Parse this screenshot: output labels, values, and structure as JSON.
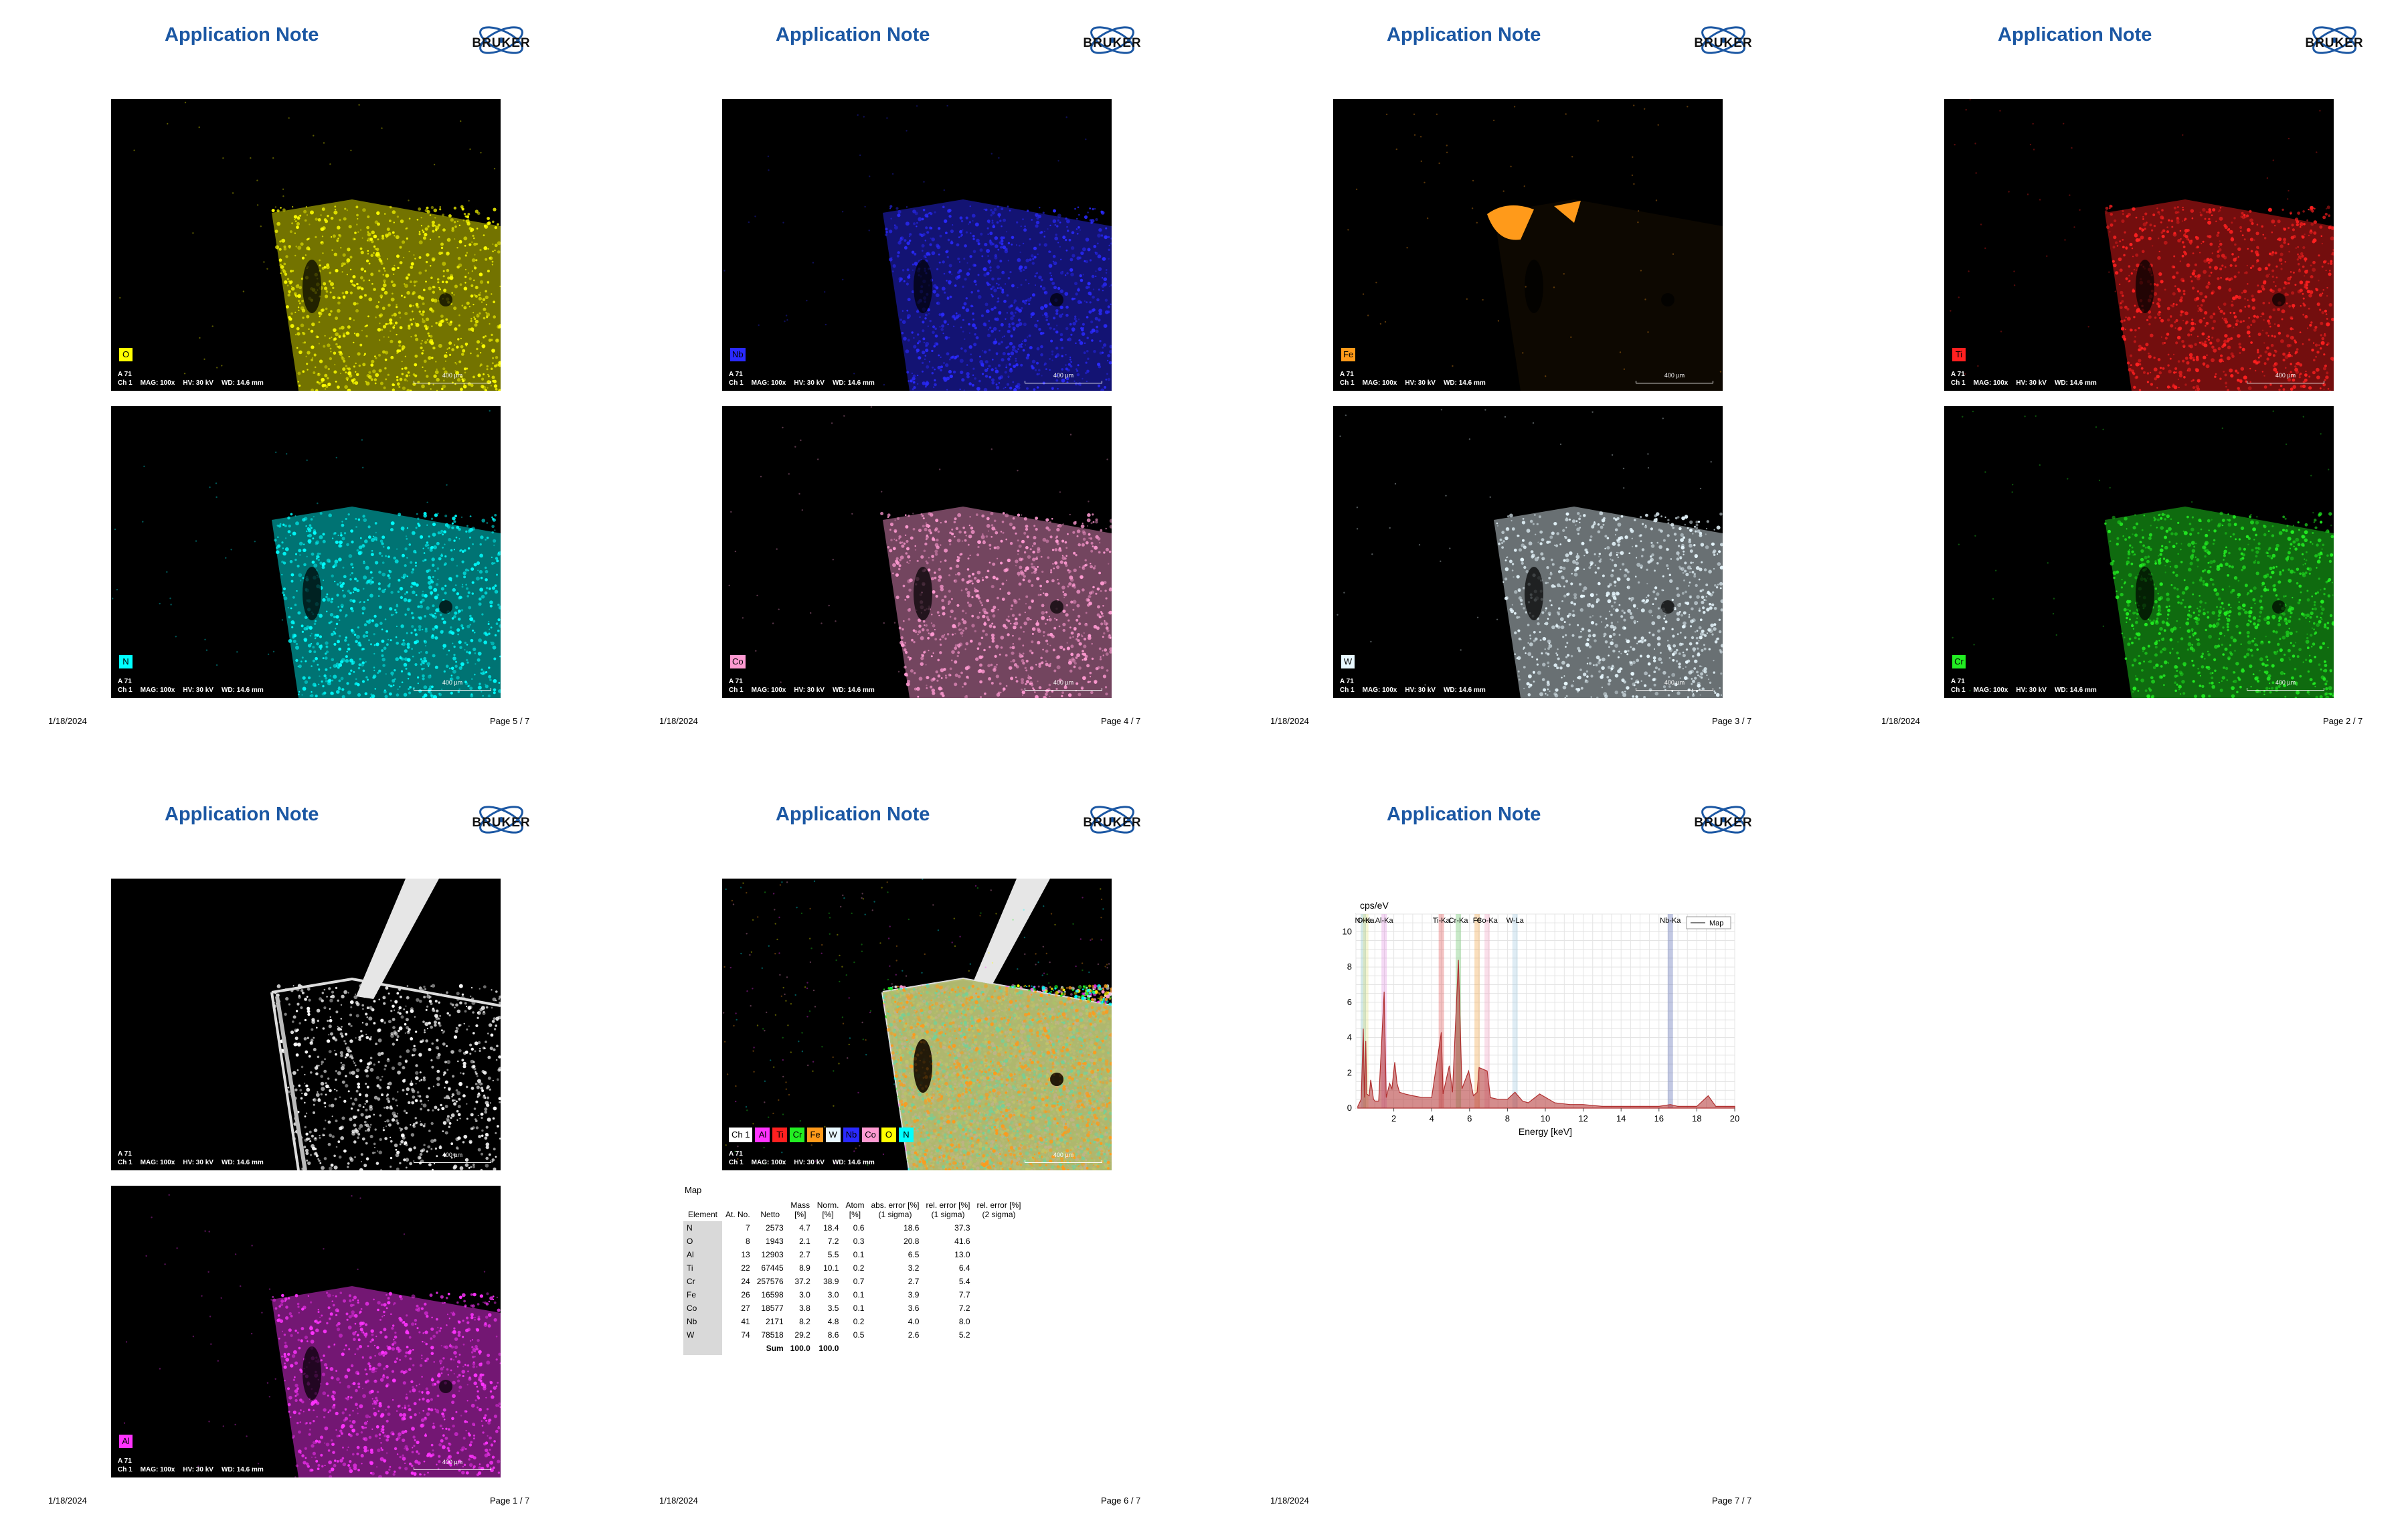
{
  "header_title": "Application Note",
  "logo_text": "BRUKER",
  "image_caption": {
    "label": "A 71",
    "channel": "Ch 1",
    "mag": "MAG: 100x",
    "hv": "HV: 30 kV",
    "wd": "WD: 14.6 mm",
    "scale": "400 µm"
  },
  "pages": [
    {
      "date": "1/18/2024",
      "page": "Page 5 / 7",
      "images": [
        {
          "element": "O",
          "color": "#ffff00"
        },
        {
          "element": "N",
          "color": "#00ffff"
        }
      ]
    },
    {
      "date": "1/18/2024",
      "page": "Page 4 / 7",
      "images": [
        {
          "element": "Nb",
          "color": "#2a2aff"
        },
        {
          "element": "Co",
          "color": "#ff9ad2"
        }
      ]
    },
    {
      "date": "1/18/2024",
      "page": "Page 3 / 7",
      "images": [
        {
          "element": "Fe",
          "color": "#ff9a1a"
        },
        {
          "element": "W",
          "color": "#e8f8ff"
        }
      ]
    },
    {
      "date": "1/18/2024",
      "page": "Page 2 / 7",
      "images": [
        {
          "element": "Ti",
          "color": "#ff2020"
        },
        {
          "element": "Cr",
          "color": "#22ee22"
        }
      ]
    },
    {
      "date": "1/18/2024",
      "page": "Page 1 / 7",
      "images": [
        {
          "element": "",
          "color": "#ffffff"
        },
        {
          "element": "Al",
          "color": "#ff33ff"
        }
      ]
    },
    {
      "date": "1/18/2024",
      "page": "Page 6 / 7"
    },
    {
      "date": "1/18/2024",
      "page": "Page 7 / 7"
    }
  ],
  "overlay_legend": [
    {
      "label": "Ch 1",
      "color": "#ffffff"
    },
    {
      "label": "Al",
      "color": "#ff33ff"
    },
    {
      "label": "Ti",
      "color": "#ff2020"
    },
    {
      "label": "Cr",
      "color": "#22ee22"
    },
    {
      "label": "Fe",
      "color": "#ff9a1a"
    },
    {
      "label": "W",
      "color": "#e8f8ff"
    },
    {
      "label": "Nb",
      "color": "#2a2aff"
    },
    {
      "label": "Co",
      "color": "#ff9ad2"
    },
    {
      "label": "O",
      "color": "#ffff00"
    },
    {
      "label": "N",
      "color": "#00ffff"
    }
  ],
  "quant_table": {
    "title": "Map",
    "headers": [
      "Element",
      "At. No.",
      "Netto",
      "Mass [%]",
      "Mass Norm. [%]",
      "Atom [%]",
      "abs. error [%] (1 sigma)",
      "rel. error [%] (1 sigma)",
      "rel. error [%] (2 sigma)"
    ],
    "header_lines": [
      [
        "Element"
      ],
      [
        "At. No."
      ],
      [
        "Netto"
      ],
      [
        "Mass",
        "[%]"
      ],
      [
        "Norm.",
        "[%]"
      ],
      [
        "Atom",
        "[%]"
      ],
      [
        "abs. error [%]",
        "(1 sigma)"
      ],
      [
        "rel. error [%]",
        "(1 sigma)"
      ],
      [
        "rel. error [%]",
        "(2 sigma)"
      ]
    ],
    "rows": [
      [
        "N",
        "7",
        "2573",
        "4.7",
        "18.4",
        "0.6",
        "18.6",
        "37.3"
      ],
      [
        "O",
        "8",
        "1943",
        "2.1",
        "7.2",
        "0.3",
        "20.8",
        "41.6"
      ],
      [
        "Al",
        "13",
        "12903",
        "2.7",
        "5.5",
        "0.1",
        "6.5",
        "13.0"
      ],
      [
        "Ti",
        "22",
        "67445",
        "8.9",
        "10.1",
        "0.2",
        "3.2",
        "6.4"
      ],
      [
        "Cr",
        "24",
        "257576",
        "37.2",
        "38.9",
        "0.7",
        "2.7",
        "5.4"
      ],
      [
        "Fe",
        "26",
        "16598",
        "3.0",
        "3.0",
        "0.1",
        "3.9",
        "7.7"
      ],
      [
        "Co",
        "27",
        "18577",
        "3.8",
        "3.5",
        "0.1",
        "3.6",
        "7.2"
      ],
      [
        "Nb",
        "41",
        "2171",
        "8.2",
        "4.8",
        "0.2",
        "4.0",
        "8.0"
      ],
      [
        "W",
        "74",
        "78518",
        "29.2",
        "8.6",
        "0.5",
        "2.6",
        "5.2"
      ]
    ],
    "sum_label": "Sum",
    "sum_values": [
      "100.0",
      "100.0"
    ]
  },
  "chart_data": {
    "type": "line",
    "ylabel": "cps/eV",
    "xlabel": "Energy [keV]",
    "xlim": [
      0,
      20
    ],
    "ylim": [
      0,
      11
    ],
    "xticks": [
      2,
      4,
      6,
      8,
      10,
      12,
      14,
      16,
      18,
      20
    ],
    "yticks": [
      0,
      2,
      4,
      6,
      8,
      10
    ],
    "grid": true,
    "legend": "top-right",
    "series": [
      {
        "name": "Map",
        "color": "#b03030",
        "x": [
          0.1,
          0.28,
          0.39,
          0.45,
          0.52,
          0.57,
          0.7,
          0.78,
          0.93,
          1.0,
          1.2,
          1.49,
          1.6,
          1.78,
          1.9,
          2.05,
          2.17,
          2.3,
          2.6,
          3.0,
          3.5,
          4.0,
          4.51,
          4.6,
          4.93,
          5.1,
          5.41,
          5.6,
          5.95,
          6.2,
          6.4,
          6.5,
          6.93,
          7.1,
          7.5,
          8.0,
          8.4,
          8.8,
          9.1,
          9.7,
          10.5,
          11.3,
          12.0,
          13.0,
          14.0,
          15.0,
          16.0,
          16.6,
          17.0,
          18.0,
          18.6,
          19.0,
          20.0
        ],
        "y": [
          0.1,
          0.5,
          4.5,
          0.6,
          3.8,
          0.8,
          0.7,
          1.6,
          0.5,
          0.4,
          0.4,
          6.6,
          0.6,
          1.4,
          1.1,
          2.6,
          1.4,
          0.9,
          0.8,
          0.7,
          0.6,
          0.6,
          4.3,
          0.8,
          2.4,
          0.9,
          8.4,
          1.1,
          2.1,
          0.7,
          0.9,
          2.3,
          2.1,
          0.6,
          0.5,
          0.5,
          0.9,
          0.4,
          0.3,
          0.8,
          0.3,
          0.2,
          0.2,
          0.1,
          0.1,
          0.1,
          0.1,
          0.2,
          0.1,
          0.1,
          0.7,
          0.1,
          0.1
        ]
      }
    ],
    "peak_labels": [
      {
        "label": "N-Ka",
        "x": 0.39
      },
      {
        "label": "O-Ka",
        "x": 0.52
      },
      {
        "label": "Al-Ka",
        "x": 1.49
      },
      {
        "label": "Ti-Ka",
        "x": 4.51
      },
      {
        "label": "Cr-Ka",
        "x": 5.41
      },
      {
        "label": "Fe",
        "x": 6.4
      },
      {
        "label": "Co-Ka",
        "x": 6.93
      },
      {
        "label": "W-La",
        "x": 8.4
      },
      {
        "label": "Nb-Ka",
        "x": 16.6
      }
    ]
  }
}
